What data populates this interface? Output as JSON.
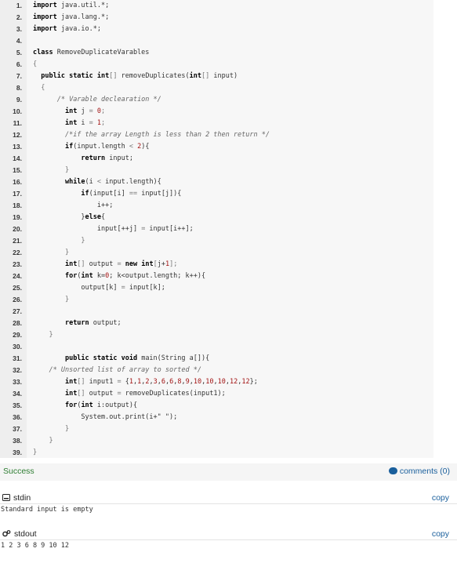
{
  "code_lines": [
    [
      [
        "kw",
        "import"
      ],
      [
        "t",
        " java.util.*;"
      ]
    ],
    [
      [
        "kw",
        "import"
      ],
      [
        "t",
        " java.lang.*;"
      ]
    ],
    [
      [
        "kw",
        "import"
      ],
      [
        "t",
        " java.io.*;"
      ]
    ],
    [],
    [
      [
        "kw",
        "class"
      ],
      [
        "t",
        " RemoveDuplicateVarables"
      ]
    ],
    [
      [
        "op",
        "{"
      ]
    ],
    [
      [
        "t",
        "  "
      ],
      [
        "kw",
        "public static int"
      ],
      [
        "op",
        "[]"
      ],
      [
        "t",
        " removeDuplicates("
      ],
      [
        "kw",
        "int"
      ],
      [
        "op",
        "[]"
      ],
      [
        "t",
        " input)"
      ]
    ],
    [
      [
        "t",
        "  "
      ],
      [
        "op",
        "{"
      ]
    ],
    [
      [
        "t",
        "      "
      ],
      [
        "cm",
        "/* Varable declearation */"
      ]
    ],
    [
      [
        "t",
        "        "
      ],
      [
        "kw",
        "int"
      ],
      [
        "t",
        " j "
      ],
      [
        "op",
        "="
      ],
      [
        "t",
        " "
      ],
      [
        "num",
        "0"
      ],
      [
        "op",
        ";"
      ]
    ],
    [
      [
        "t",
        "        "
      ],
      [
        "kw",
        "int"
      ],
      [
        "t",
        " i "
      ],
      [
        "op",
        "="
      ],
      [
        "t",
        " "
      ],
      [
        "num",
        "1"
      ],
      [
        "op",
        ";"
      ]
    ],
    [
      [
        "t",
        "        "
      ],
      [
        "cm",
        "/*if the array Length is less than 2 then return */"
      ]
    ],
    [
      [
        "t",
        "        "
      ],
      [
        "kw",
        "if"
      ],
      [
        "t",
        "(input.length "
      ],
      [
        "op",
        "<"
      ],
      [
        "t",
        " "
      ],
      [
        "num",
        "2"
      ],
      [
        "t",
        "){"
      ]
    ],
    [
      [
        "t",
        "            "
      ],
      [
        "kw",
        "return"
      ],
      [
        "t",
        " input;"
      ]
    ],
    [
      [
        "t",
        "        "
      ],
      [
        "op",
        "}"
      ]
    ],
    [
      [
        "t",
        "        "
      ],
      [
        "kw",
        "while"
      ],
      [
        "t",
        "(i "
      ],
      [
        "op",
        "<"
      ],
      [
        "t",
        " input.length){"
      ]
    ],
    [
      [
        "t",
        "            "
      ],
      [
        "kw",
        "if"
      ],
      [
        "t",
        "(input[i] "
      ],
      [
        "op",
        "=="
      ],
      [
        "t",
        " input[j]){"
      ]
    ],
    [
      [
        "t",
        "                "
      ],
      [
        "t",
        "i++;"
      ]
    ],
    [
      [
        "t",
        "            "
      ],
      [
        "t",
        "}"
      ],
      [
        "kw",
        "else"
      ],
      [
        "t",
        "{"
      ]
    ],
    [
      [
        "t",
        "                "
      ],
      [
        "t",
        "input[++j] "
      ],
      [
        "op",
        "="
      ],
      [
        "t",
        " input[i++];"
      ]
    ],
    [
      [
        "t",
        "            "
      ],
      [
        "op",
        "}"
      ]
    ],
    [
      [
        "t",
        "        "
      ],
      [
        "op",
        "}"
      ]
    ],
    [
      [
        "t",
        "        "
      ],
      [
        "kw",
        "int"
      ],
      [
        "op",
        "[]"
      ],
      [
        "t",
        " output "
      ],
      [
        "op",
        "="
      ],
      [
        "t",
        " "
      ],
      [
        "kw",
        "new int"
      ],
      [
        "op",
        "["
      ],
      [
        "t",
        "j+"
      ],
      [
        "num",
        "1"
      ],
      [
        "op",
        "];"
      ]
    ],
    [
      [
        "t",
        "        "
      ],
      [
        "kw",
        "for"
      ],
      [
        "t",
        "("
      ],
      [
        "kw",
        "int"
      ],
      [
        "t",
        " k="
      ],
      [
        "num",
        "0"
      ],
      [
        "t",
        "; k<output.length; k++){"
      ]
    ],
    [
      [
        "t",
        "            "
      ],
      [
        "t",
        "output[k] "
      ],
      [
        "op",
        "="
      ],
      [
        "t",
        " input[k];"
      ]
    ],
    [
      [
        "t",
        "        "
      ],
      [
        "op",
        "}"
      ]
    ],
    [],
    [
      [
        "t",
        "        "
      ],
      [
        "kw",
        "return"
      ],
      [
        "t",
        " output;"
      ]
    ],
    [
      [
        "t",
        "    "
      ],
      [
        "op",
        "}"
      ]
    ],
    [],
    [
      [
        "t",
        "        "
      ],
      [
        "kw",
        "public static void"
      ],
      [
        "t",
        " main(String a[]){"
      ]
    ],
    [
      [
        "t",
        "    "
      ],
      [
        "cm",
        "/* Unsorted list of array to sorted */"
      ]
    ],
    [
      [
        "t",
        "        "
      ],
      [
        "kw",
        "int"
      ],
      [
        "op",
        "[]"
      ],
      [
        "t",
        " input1 "
      ],
      [
        "op",
        "="
      ],
      [
        "t",
        " {"
      ],
      [
        "num",
        "1"
      ],
      [
        "t",
        ","
      ],
      [
        "num",
        "1"
      ],
      [
        "t",
        ","
      ],
      [
        "num",
        "2"
      ],
      [
        "t",
        ","
      ],
      [
        "num",
        "3"
      ],
      [
        "t",
        ","
      ],
      [
        "num",
        "6"
      ],
      [
        "t",
        ","
      ],
      [
        "num",
        "6"
      ],
      [
        "t",
        ","
      ],
      [
        "num",
        "8"
      ],
      [
        "t",
        ","
      ],
      [
        "num",
        "9"
      ],
      [
        "t",
        ","
      ],
      [
        "num",
        "10"
      ],
      [
        "t",
        ","
      ],
      [
        "num",
        "10"
      ],
      [
        "t",
        ","
      ],
      [
        "num",
        "10"
      ],
      [
        "t",
        ","
      ],
      [
        "num",
        "12"
      ],
      [
        "t",
        ","
      ],
      [
        "num",
        "12"
      ],
      [
        "t",
        "};"
      ]
    ],
    [
      [
        "t",
        "        "
      ],
      [
        "kw",
        "int"
      ],
      [
        "op",
        "[]"
      ],
      [
        "t",
        " output "
      ],
      [
        "op",
        "="
      ],
      [
        "t",
        " removeDuplicates(input1);"
      ]
    ],
    [
      [
        "t",
        "        "
      ],
      [
        "kw",
        "for"
      ],
      [
        "t",
        "("
      ],
      [
        "kw",
        "int"
      ],
      [
        "t",
        " i:output){"
      ]
    ],
    [
      [
        "t",
        "            "
      ],
      [
        "t",
        "System.out.print(i+"
      ],
      [
        "str",
        "\" \""
      ],
      [
        "t",
        ");"
      ]
    ],
    [
      [
        "t",
        "        "
      ],
      [
        "op",
        "}"
      ]
    ],
    [
      [
        "t",
        "    "
      ],
      [
        "op",
        "}"
      ]
    ],
    [
      [
        "op",
        "}"
      ]
    ]
  ],
  "result": {
    "status": "Success",
    "comments_label": "comments (0)"
  },
  "stdin": {
    "label": "stdin",
    "copy_label": "copy",
    "content": "Standard input is empty"
  },
  "stdout": {
    "label": "stdout",
    "copy_label": "copy",
    "content": "1 2 3 6 8 9 10 12"
  },
  "colors": {
    "success": "#2e7d32",
    "link": "#1a5f9c"
  }
}
